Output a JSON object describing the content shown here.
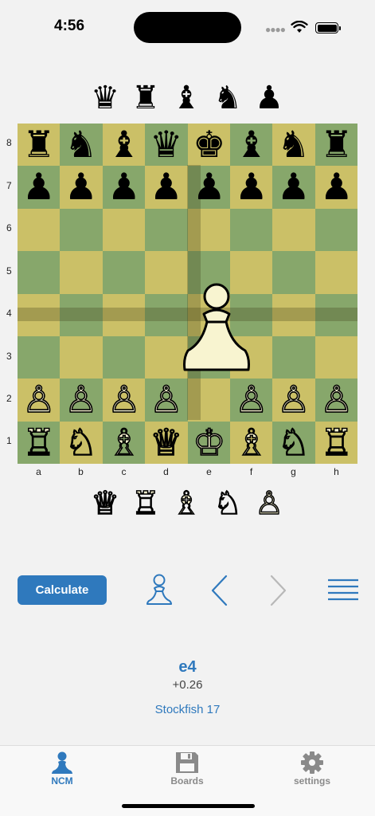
{
  "status_bar": {
    "time": "4:56"
  },
  "captured_black": [
    "♛",
    "♜",
    "♝",
    "♞",
    "♟"
  ],
  "captured_white": [
    "♕",
    "♖",
    "♗",
    "♘",
    "♙"
  ],
  "board": {
    "ranks": [
      "8",
      "7",
      "6",
      "5",
      "4",
      "3",
      "2",
      "1"
    ],
    "files": [
      "a",
      "b",
      "c",
      "d",
      "e",
      "f",
      "g",
      "h"
    ],
    "rank8": [
      "♜",
      "♞",
      "♝",
      "♛",
      "♚",
      "♝",
      "♞",
      "♜"
    ],
    "rank7": [
      "♟",
      "♟",
      "♟",
      "♟",
      "♟",
      "♟",
      "♟",
      "♟"
    ],
    "rank2": [
      "♙",
      "♙",
      "♙",
      "♙",
      "",
      "♙",
      "♙",
      "♙"
    ],
    "rank1": [
      "♖",
      "♘",
      "♗",
      "♕",
      "♔",
      "♗",
      "♘",
      "♖"
    ],
    "light_color": "#cbc067",
    "dark_color": "#87a76b"
  },
  "controls": {
    "calculate_label": "Calculate",
    "side_icon": "pawn-icon",
    "back_icon": "chevron-left-icon",
    "forward_icon": "chevron-right-icon",
    "menu_icon": "menu-icon"
  },
  "result": {
    "move": "e4",
    "eval": "+0.26",
    "engine": "Stockfish 17"
  },
  "tabs": [
    {
      "label": "NCM",
      "icon": "pawn-icon",
      "active": true
    },
    {
      "label": "Boards",
      "icon": "floppy-disk-icon",
      "active": false
    },
    {
      "label": "settings",
      "icon": "gear-icon",
      "active": false
    }
  ],
  "colors": {
    "accent": "#2f79bd",
    "inactive": "#8a8a8a"
  }
}
